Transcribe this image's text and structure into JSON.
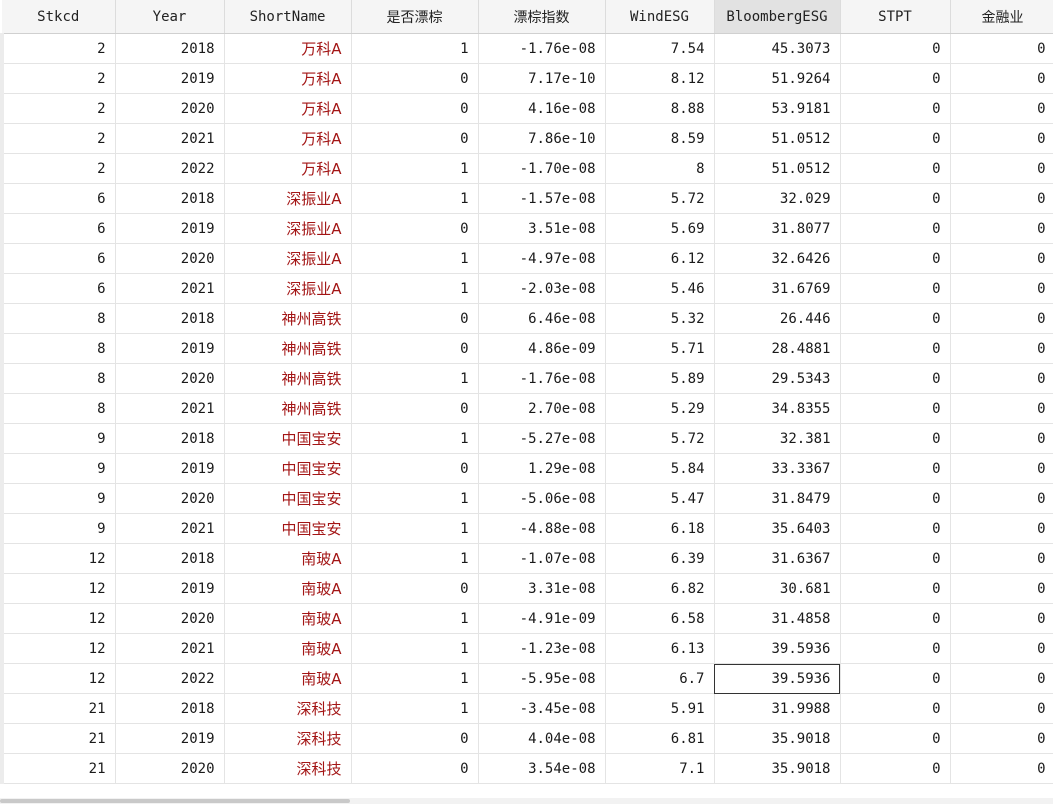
{
  "grid": {
    "columns": [
      "Stkcd",
      "Year",
      "ShortName",
      "是否漂棕",
      "漂棕指数",
      "WindESG",
      "BloombergESG",
      "STPT",
      "金融业"
    ],
    "selected_column": "BloombergESG",
    "rows": [
      [
        "2",
        "2018",
        "万科A",
        "1",
        "-1.76e-08",
        "7.54",
        "45.3073",
        "0",
        "0"
      ],
      [
        "2",
        "2019",
        "万科A",
        "0",
        "7.17e-10",
        "8.12",
        "51.9264",
        "0",
        "0"
      ],
      [
        "2",
        "2020",
        "万科A",
        "0",
        "4.16e-08",
        "8.88",
        "53.9181",
        "0",
        "0"
      ],
      [
        "2",
        "2021",
        "万科A",
        "0",
        "7.86e-10",
        "8.59",
        "51.0512",
        "0",
        "0"
      ],
      [
        "2",
        "2022",
        "万科A",
        "1",
        "-1.70e-08",
        "8",
        "51.0512",
        "0",
        "0"
      ],
      [
        "6",
        "2018",
        "深振业A",
        "1",
        "-1.57e-08",
        "5.72",
        "32.029",
        "0",
        "0"
      ],
      [
        "6",
        "2019",
        "深振业A",
        "0",
        "3.51e-08",
        "5.69",
        "31.8077",
        "0",
        "0"
      ],
      [
        "6",
        "2020",
        "深振业A",
        "1",
        "-4.97e-08",
        "6.12",
        "32.6426",
        "0",
        "0"
      ],
      [
        "6",
        "2021",
        "深振业A",
        "1",
        "-2.03e-08",
        "5.46",
        "31.6769",
        "0",
        "0"
      ],
      [
        "8",
        "2018",
        "神州高铁",
        "0",
        "6.46e-08",
        "5.32",
        "26.446",
        "0",
        "0"
      ],
      [
        "8",
        "2019",
        "神州高铁",
        "0",
        "4.86e-09",
        "5.71",
        "28.4881",
        "0",
        "0"
      ],
      [
        "8",
        "2020",
        "神州高铁",
        "1",
        "-1.76e-08",
        "5.89",
        "29.5343",
        "0",
        "0"
      ],
      [
        "8",
        "2021",
        "神州高铁",
        "0",
        "2.70e-08",
        "5.29",
        "34.8355",
        "0",
        "0"
      ],
      [
        "9",
        "2018",
        "中国宝安",
        "1",
        "-5.27e-08",
        "5.72",
        "32.381",
        "0",
        "0"
      ],
      [
        "9",
        "2019",
        "中国宝安",
        "0",
        "1.29e-08",
        "5.84",
        "33.3367",
        "0",
        "0"
      ],
      [
        "9",
        "2020",
        "中国宝安",
        "1",
        "-5.06e-08",
        "5.47",
        "31.8479",
        "0",
        "0"
      ],
      [
        "9",
        "2021",
        "中国宝安",
        "1",
        "-4.88e-08",
        "6.18",
        "35.6403",
        "0",
        "0"
      ],
      [
        "12",
        "2018",
        "南玻A",
        "1",
        "-1.07e-08",
        "6.39",
        "31.6367",
        "0",
        "0"
      ],
      [
        "12",
        "2019",
        "南玻A",
        "0",
        "3.31e-08",
        "6.82",
        "30.681",
        "0",
        "0"
      ],
      [
        "12",
        "2020",
        "南玻A",
        "1",
        "-4.91e-09",
        "6.58",
        "31.4858",
        "0",
        "0"
      ],
      [
        "12",
        "2021",
        "南玻A",
        "1",
        "-1.23e-08",
        "6.13",
        "39.5936",
        "0",
        "0"
      ],
      [
        "12",
        "2022",
        "南玻A",
        "1",
        "-5.95e-08",
        "6.7",
        "39.5936",
        "0",
        "0"
      ],
      [
        "21",
        "2018",
        "深科技",
        "1",
        "-3.45e-08",
        "5.91",
        "31.9988",
        "0",
        "0"
      ],
      [
        "21",
        "2019",
        "深科技",
        "0",
        "4.04e-08",
        "6.81",
        "35.9018",
        "0",
        "0"
      ],
      [
        "21",
        "2020",
        "深科技",
        "0",
        "3.54e-08",
        "7.1",
        "35.9018",
        "0",
        "0"
      ]
    ],
    "active_cell": {
      "row": 21,
      "col": 6
    }
  },
  "colors": {
    "name_text": "#a31515",
    "header_bg": "#f5f5f5",
    "selected_header_bg": "#e2e2e2"
  }
}
